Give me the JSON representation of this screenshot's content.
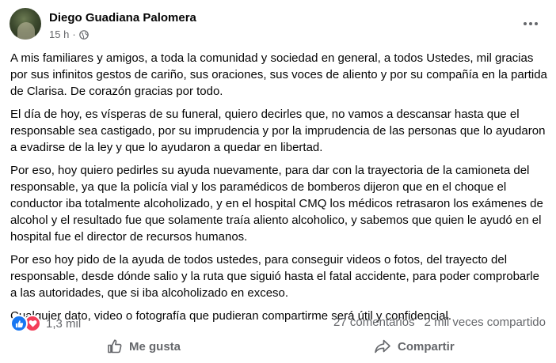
{
  "post": {
    "author": "Diego Guadiana Palomera",
    "time": "15 h",
    "separator": "·",
    "paragraphs": [
      "A mis familiares y amigos, a toda la comunidad y sociedad en general, a todos Ustedes, mil gracias por sus infinitos gestos de cariño, sus oraciones, sus voces de aliento y por su compañía en la partida de Clarisa. De corazón gracias por todo.",
      "El día de hoy, es vísperas de su funeral, quiero decirles que, no vamos a descansar hasta que el responsable sea castigado, por su imprudencia y por la imprudencia de las personas que lo ayudaron a evadirse de la ley y que lo ayudaron a quedar en libertad.",
      "Por eso, hoy quiero pedirles su ayuda nuevamente, para dar con la trayectoria de la camioneta del responsable, ya que la policía vial y los paramédicos de bomberos dijeron que en el choque el conductor iba totalmente alcoholizado, y en el hospital CMQ los médicos retrasaron los exámenes de alcohol y el resultado fue que solamente traía aliento alcoholico, y sabemos que quien le ayudó en el hospital fue el director de recursos humanos.",
      "Por eso hoy pido de la ayuda de todos ustedes, para conseguir videos o fotos, del trayecto del responsable, desde dónde salio y la ruta que siguió hasta el fatal accidente, para poder comprobarle a las autoridades, que si iba alcoholizado en exceso.",
      "Cualquier dato, video o fotografía que pudieran compartirme será útil y confidencial."
    ]
  },
  "stats": {
    "reactions_count": "1,3 mil",
    "comments": "27 comentarios",
    "shares": "2 mil veces compartido"
  },
  "actions": {
    "like_label": "Me gusta",
    "share_label": "Compartir"
  },
  "icons": {
    "more": "more-options-icon",
    "audience": "globe-icon",
    "reaction_like": "like-reaction-icon",
    "reaction_love": "love-reaction-icon",
    "like": "thumbs-up-icon",
    "share": "share-arrow-icon"
  },
  "colors": {
    "text": "#050505",
    "secondary": "#65676b",
    "like_blue": "#1877f2",
    "love_red": "#f33e58"
  }
}
